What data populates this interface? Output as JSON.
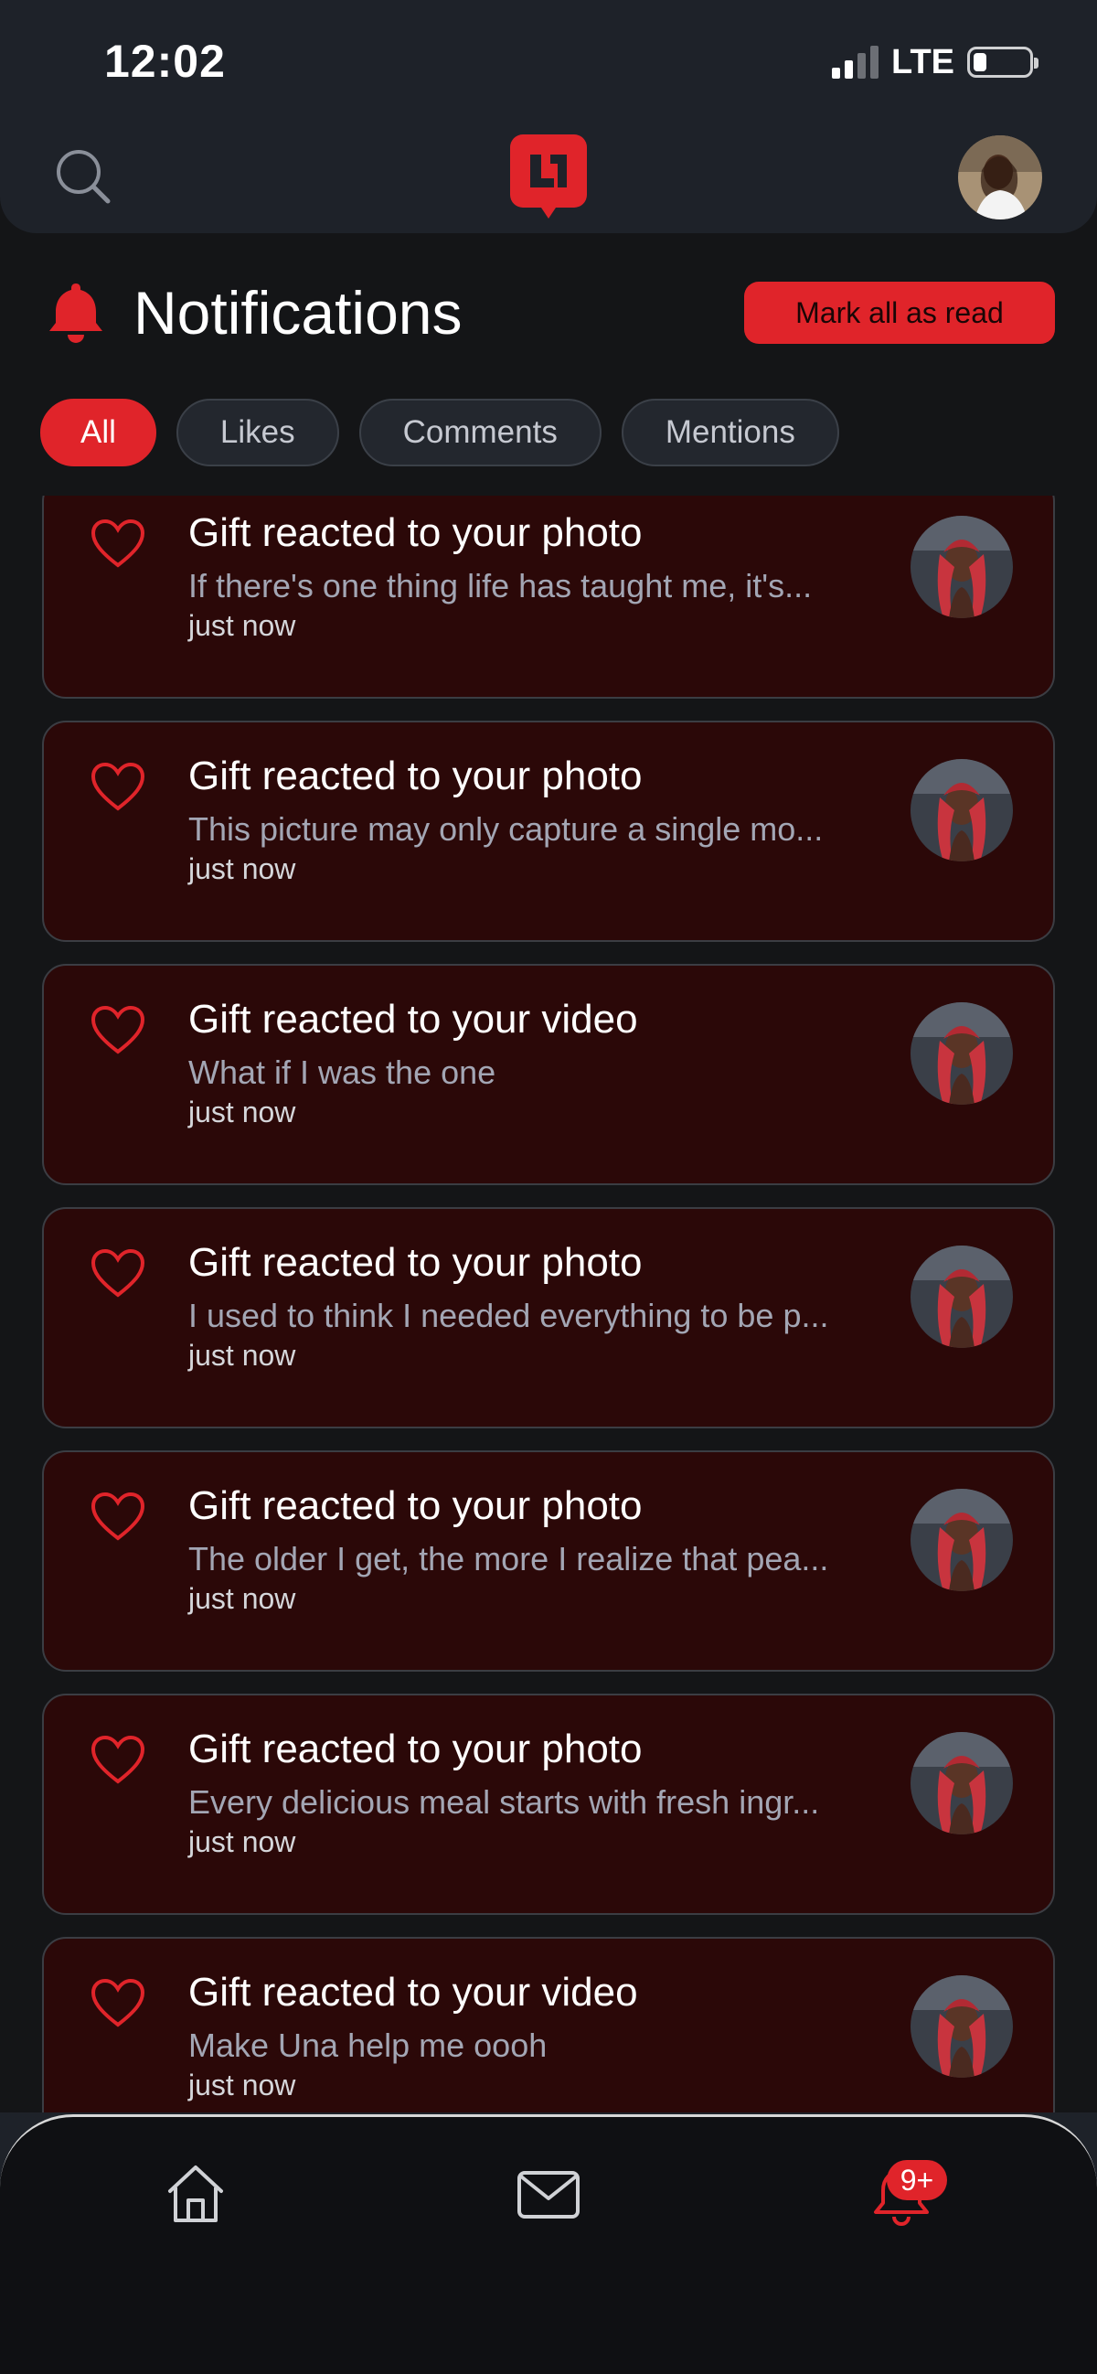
{
  "status_bar": {
    "time": "12:02",
    "network": "LTE"
  },
  "header": {
    "search_icon": "search-icon",
    "logo_icon": "app-logo",
    "avatar_icon": "profile-avatar"
  },
  "page": {
    "title": "Notifications",
    "mark_all_label": "Mark all as read"
  },
  "filters": [
    {
      "label": "All",
      "active": true
    },
    {
      "label": "Likes",
      "active": false
    },
    {
      "label": "Comments",
      "active": false
    },
    {
      "label": "Mentions",
      "active": false
    }
  ],
  "notifications": [
    {
      "title": "Gift reacted to your photo",
      "preview": "If there's one thing life has taught me, it's...",
      "time": "just now"
    },
    {
      "title": "Gift reacted to your photo",
      "preview": "This picture may only capture a single mo...",
      "time": "just now"
    },
    {
      "title": "Gift reacted to your video",
      "preview": "What if I was the one",
      "time": "just now"
    },
    {
      "title": "Gift reacted to your photo",
      "preview": "I used to think I needed everything to be p...",
      "time": "just now"
    },
    {
      "title": "Gift reacted to your photo",
      "preview": "The older I get, the more I realize that pea...",
      "time": "just now"
    },
    {
      "title": "Gift reacted to your photo",
      "preview": "Every delicious meal starts with fresh ingr...",
      "time": "just now"
    },
    {
      "title": "Gift reacted to your video",
      "preview": "Make Una help me oooh",
      "time": "just now"
    }
  ],
  "bottom_nav": {
    "notification_badge": "9+"
  },
  "colors": {
    "accent": "#e0242a",
    "card_bg": "#2b0808",
    "header_bg": "#1e2229",
    "page_bg": "#141517"
  }
}
